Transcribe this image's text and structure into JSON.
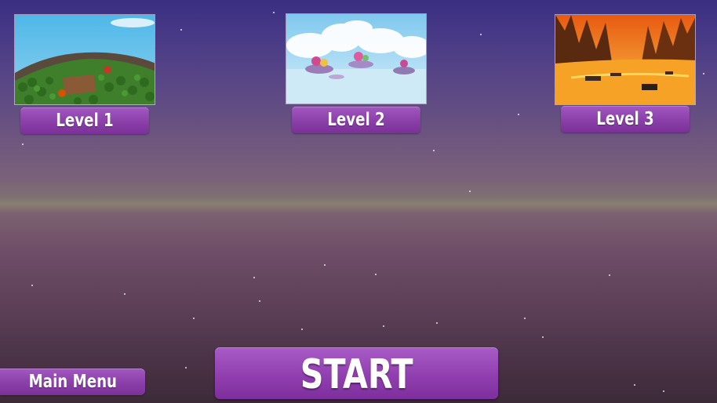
{
  "levels": [
    {
      "label": "Level 1",
      "scene": "forest-island"
    },
    {
      "label": "Level 2",
      "scene": "sky-islands"
    },
    {
      "label": "Level 3",
      "scene": "lava-world"
    }
  ],
  "buttons": {
    "main_menu": "Main Menu",
    "start": "START"
  },
  "colors": {
    "button_purple": "#8a3fa9",
    "sky_top": "#3a2f82",
    "sky_bottom": "#3c2a39"
  }
}
